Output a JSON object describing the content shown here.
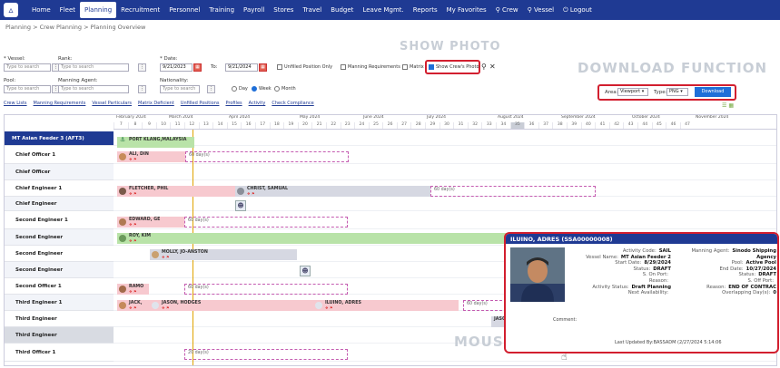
{
  "nav": {
    "items": [
      "Home",
      "Fleet",
      "Planning",
      "Recruitment",
      "Personnel",
      "Training",
      "Payroll",
      "Stores",
      "Travel",
      "Budget",
      "Leave Mgmt.",
      "Reports",
      "My Favorites",
      "Crew",
      "Vessel",
      "Logout"
    ],
    "active": "Planning"
  },
  "breadcrumb": "Planning > Crew Planning > Planning Overview",
  "watermarks": {
    "show_photo": "SHOW PHOTO",
    "download": "DOWNLOAD FUNCTION",
    "mouseover": "MOUSEOVER"
  },
  "filters": {
    "vessel_label": "* Vessel:",
    "rank_label": "Rank:",
    "date_label": "* Date:",
    "pool_label": "Pool:",
    "manning_label": "Manning Agent:",
    "nationality_label": "Nationality:",
    "placeholder": "Type to search",
    "date_from": "9/21/2023",
    "to_label": "To:",
    "date_to": "9/21/2024",
    "chk_unfilled": "Unfilled Position Only",
    "chk_manning": "Manning Requirements",
    "chk_matrix": "Matrix",
    "chk_photo": "Show Crew's Photo",
    "radio_day": "Day",
    "radio_week": "Week",
    "radio_month": "Month",
    "area_label": "Area:",
    "area_value": "Viewport",
    "type_label": "Type:",
    "type_value": "PNG",
    "download_btn": "Download"
  },
  "links": [
    "Crew Lists",
    "Manning Requirements",
    "Vessel Particulars",
    "Matrix Deficient",
    "Unfilled Positions",
    "Profiles",
    "Activity",
    "Check Compliance"
  ],
  "timeline": {
    "months": [
      "February 2024",
      "March 2024",
      "April 2024",
      "May 2024",
      "June 2024",
      "July 2024",
      "August 2024",
      "September 2024",
      "October 2024",
      "November 2024"
    ],
    "weeks": [
      "7",
      "8",
      "9",
      "10",
      "11",
      "12",
      "13",
      "14",
      "15",
      "16",
      "17",
      "18",
      "19",
      "20",
      "21",
      "22",
      "23",
      "24",
      "25",
      "26",
      "27",
      "28",
      "29",
      "30",
      "31",
      "32",
      "33",
      "34",
      "35",
      "36",
      "37",
      "38",
      "39",
      "40",
      "41",
      "42",
      "43",
      "44",
      "45",
      "46",
      "47"
    ],
    "current_week": "35"
  },
  "rows": [
    {
      "label": "MT Asian Feeder 3 (AFT3)",
      "kind": "group"
    },
    {
      "label": "Chief Officer 1",
      "kind": "normal"
    },
    {
      "label": "Chief Officer",
      "kind": "alt"
    },
    {
      "label": "Chief Engineer 1",
      "kind": "normal"
    },
    {
      "label": "Chief Engineer",
      "kind": "alt"
    },
    {
      "label": "Second Engineer 1",
      "kind": "normal"
    },
    {
      "label": "Second Engineer",
      "kind": "alt"
    },
    {
      "label": "Second Engineer",
      "kind": "normal"
    },
    {
      "label": "Second Engineer",
      "kind": "alt"
    },
    {
      "label": "Second Officer 1",
      "kind": "normal"
    },
    {
      "label": "Third Engineer 1",
      "kind": "alt"
    },
    {
      "label": "Third Engineer",
      "kind": "normal"
    },
    {
      "label": "Third Engineer",
      "kind": "hl"
    },
    {
      "label": "Third Officer 1",
      "kind": "normal"
    }
  ],
  "bars": {
    "port": "PORT KLANG,MALAYSIA",
    "ali": "ALI, DIN",
    "fletcher": "FLETCHER, PHIL",
    "christ": "CHRIST, SAMUAL",
    "edward": "EDWARD, GE",
    "roy": "ROY, KIM",
    "molly": "MOLLY, JO-ANSTON",
    "ramos": "RAMO",
    "jack": "JACK,",
    "jason": "JASON, HODGES",
    "iluino": "ILUINO, ADRES",
    "jaso": "JASO",
    "iluino2": "ILUINO, ADRES",
    "days60": "60 day(s)",
    "days20": "20 day(s)"
  },
  "popup": {
    "title": "ILUINO, ADRES (SSA00000008)",
    "left": [
      [
        "Activity Code:",
        "SAIL"
      ],
      [
        "Vessel Name:",
        "MT Asian Feeder 2"
      ],
      [
        "Start Date:",
        "8/29/2024"
      ],
      [
        "Status:",
        "DRAFT"
      ],
      [
        "S. On Port:",
        ""
      ],
      [
        "Reason:",
        ""
      ],
      [
        "Activity Status:",
        "Draft Planning"
      ],
      [
        "Next Availability:",
        ""
      ]
    ],
    "right": [
      [
        "Manning Agent:",
        "Sinodo Shipping"
      ],
      [
        "",
        "Agency"
      ],
      [
        "Pool:",
        "Active Pool"
      ],
      [
        "End Date:",
        "10/27/2024"
      ],
      [
        "Status:",
        "DRAFT"
      ],
      [
        "S. Off Port:",
        ""
      ],
      [
        "Reason:",
        "END OF CONTRAC"
      ],
      [
        "Overlapping Day(s):",
        "0"
      ]
    ],
    "comment_label": "Comment:",
    "updated": "Last Updated By:BASSADM (2/27/2024 5:14:06"
  }
}
